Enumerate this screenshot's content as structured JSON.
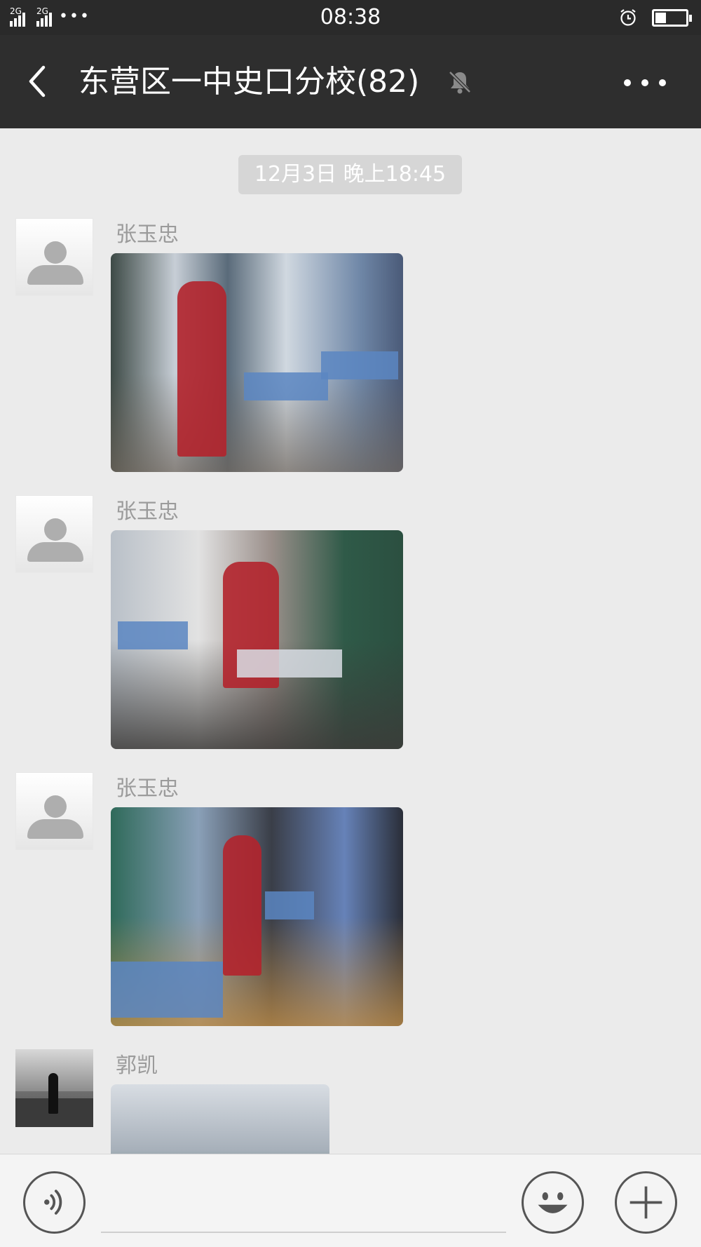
{
  "status_bar": {
    "signal_1_label": "2G",
    "signal_2_label": "2G",
    "dots": "•••",
    "time": "08:38",
    "icons": [
      "signal-icon",
      "signal-icon",
      "alarm-icon",
      "battery-icon"
    ]
  },
  "header": {
    "title": "东营区一中史口分校(82)",
    "icons": [
      "back-icon",
      "mute-bell-icon",
      "more-icon"
    ]
  },
  "chat": {
    "timestamp": "12月3日 晚上18:45",
    "messages": [
      {
        "sender": "张玉忠",
        "type": "image"
      },
      {
        "sender": "张玉忠",
        "type": "image"
      },
      {
        "sender": "张玉忠",
        "type": "image"
      },
      {
        "sender": "郭凯",
        "type": "image"
      }
    ]
  },
  "input_bar": {
    "text_value": "",
    "icons": [
      "voice-icon",
      "emoji-icon",
      "plus-icon"
    ]
  },
  "colors": {
    "header_bg": "#2e2e2e",
    "status_bar_bg": "#2a2a2a",
    "chat_bg": "#ebebeb",
    "timestamp_pill": "#d6d6d6",
    "input_bar_bg": "#f4f4f4"
  }
}
